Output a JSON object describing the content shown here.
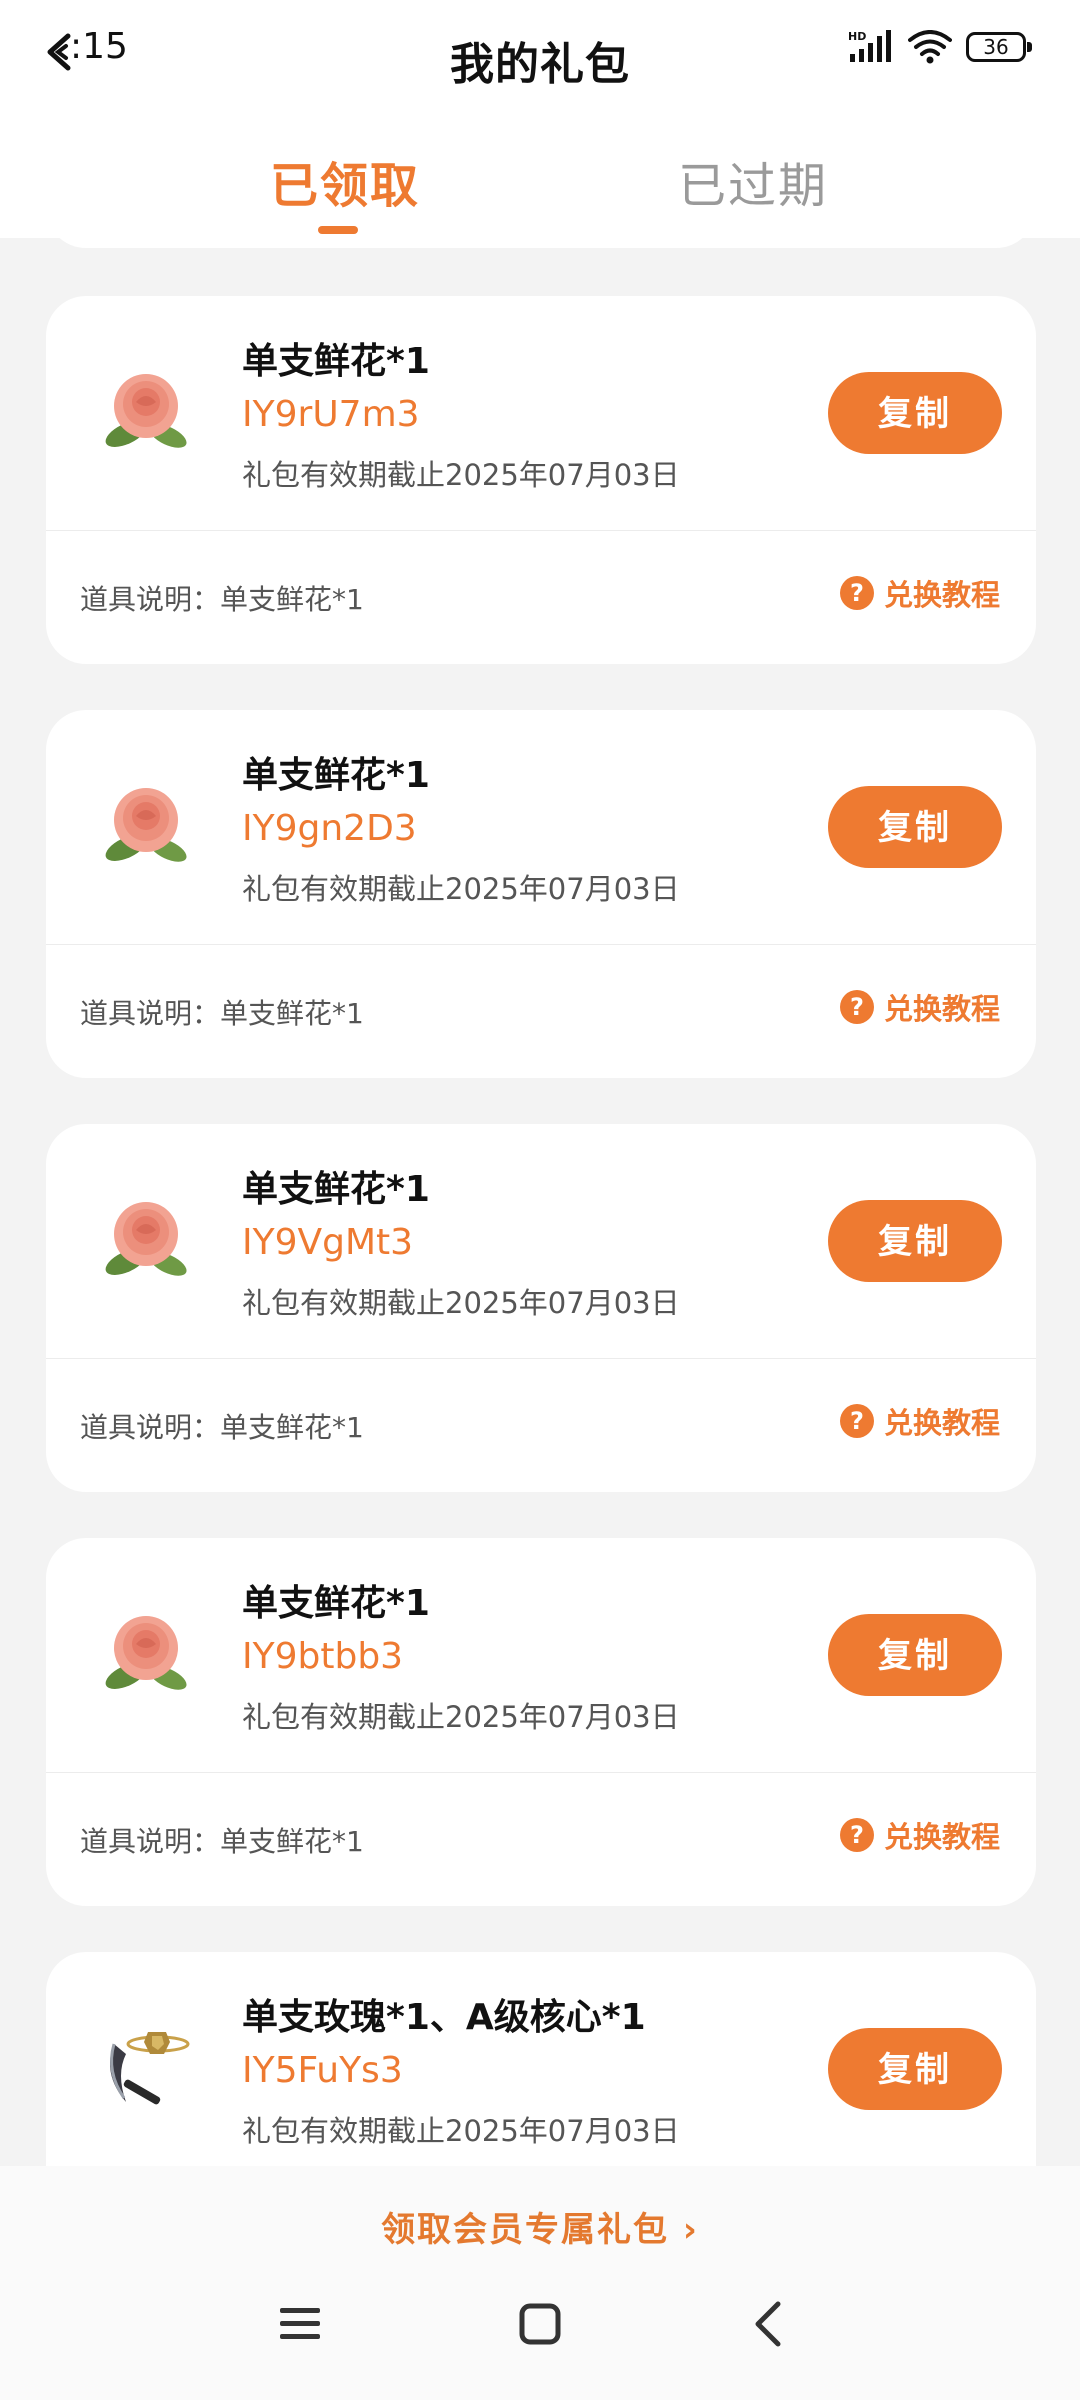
{
  "status": {
    "time": ":15",
    "battery": "36",
    "signal_badge": "HD"
  },
  "header": {
    "title": "我的礼包"
  },
  "tabs": [
    {
      "label": "已领取",
      "active": true
    },
    {
      "label": "已过期",
      "active": false
    }
  ],
  "gifts": [
    {
      "name": "单支鲜花*1",
      "code": "IY9rU7m3",
      "expiry": "礼包有效期截止2025年07月03日",
      "copy_label": "复制",
      "desc": "道具说明：单支鲜花*1",
      "tutorial_label": "兑换教程",
      "icon": "rose-icon"
    },
    {
      "name": "单支鲜花*1",
      "code": "IY9gn2D3",
      "expiry": "礼包有效期截止2025年07月03日",
      "copy_label": "复制",
      "desc": "道具说明：单支鲜花*1",
      "tutorial_label": "兑换教程",
      "icon": "rose-icon"
    },
    {
      "name": "单支鲜花*1",
      "code": "IY9VgMt3",
      "expiry": "礼包有效期截止2025年07月03日",
      "copy_label": "复制",
      "desc": "道具说明：单支鲜花*1",
      "tutorial_label": "兑换教程",
      "icon": "rose-icon"
    },
    {
      "name": "单支鲜花*1",
      "code": "IY9btbb3",
      "expiry": "礼包有效期截止2025年07月03日",
      "copy_label": "复制",
      "desc": "道具说明：单支鲜花*1",
      "tutorial_label": "兑换教程",
      "icon": "rose-icon"
    },
    {
      "name": "单支玫瑰*1、A级核心*1",
      "code": "IY5FuYs3",
      "expiry": "礼包有效期截止2025年07月03日",
      "copy_label": "复制",
      "desc": "",
      "tutorial_label": "",
      "icon": "scythe-core-icon"
    }
  ],
  "footer": {
    "member_link": "领取会员专属礼包 ›"
  },
  "colors": {
    "accent": "#ee7a31",
    "background": "#f3f3f3",
    "card": "#ffffff"
  }
}
